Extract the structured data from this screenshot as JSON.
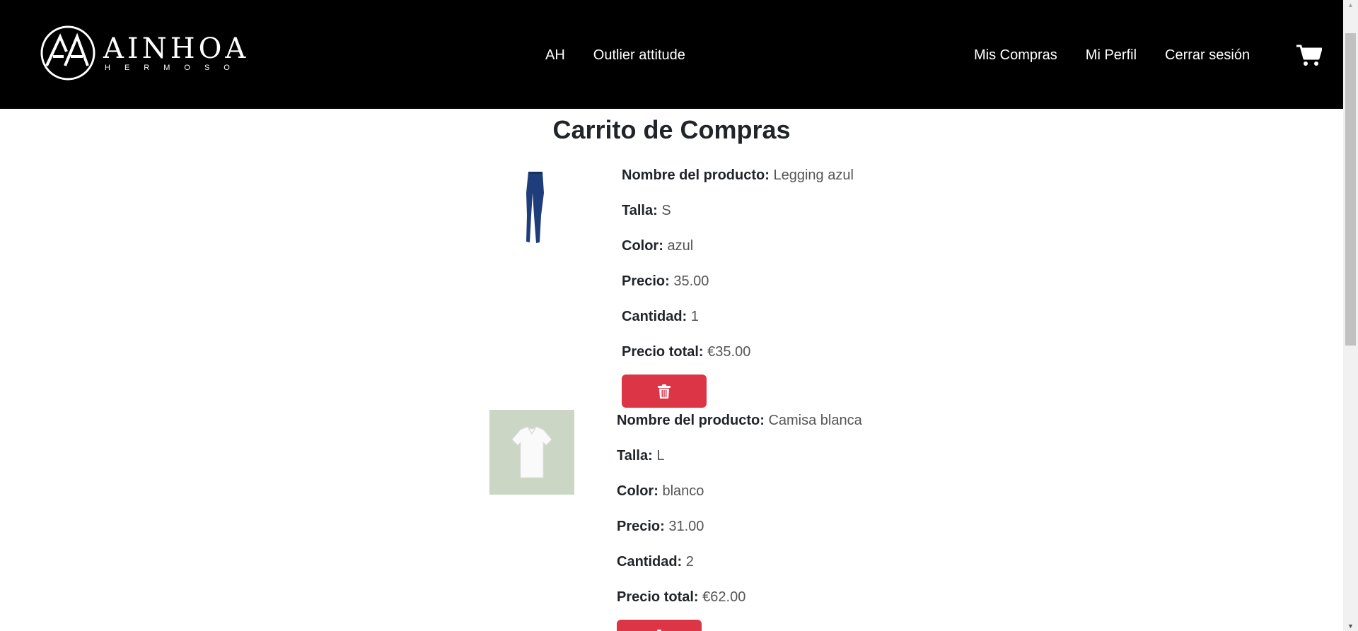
{
  "brand": {
    "name": "AINHOA",
    "subtitle": "HERMOSO"
  },
  "nav": {
    "left": [
      "AH",
      "Outlier attitude"
    ],
    "right": [
      "Mis Compras",
      "Mi Perfil",
      "Cerrar sesión"
    ]
  },
  "page_title": "Carrito de Compras",
  "labels": {
    "name": "Nombre del producto:",
    "size": "Talla:",
    "color": "Color:",
    "price": "Precio:",
    "quantity": "Cantidad:",
    "total": "Precio total:"
  },
  "cart_items": [
    {
      "name": "Legging azul",
      "size": "S",
      "color": "azul",
      "price": "35.00",
      "quantity": "1",
      "total": "€35.00"
    },
    {
      "name": "Camisa blanca",
      "size": "L",
      "color": "blanco",
      "price": "31.00",
      "quantity": "2",
      "total": "€62.00"
    }
  ],
  "colors": {
    "navbar_bg": "#000000",
    "delete_button": "#dc3545",
    "shirt_bg": "#ccd6c4",
    "legging": "#1f3d7a"
  }
}
